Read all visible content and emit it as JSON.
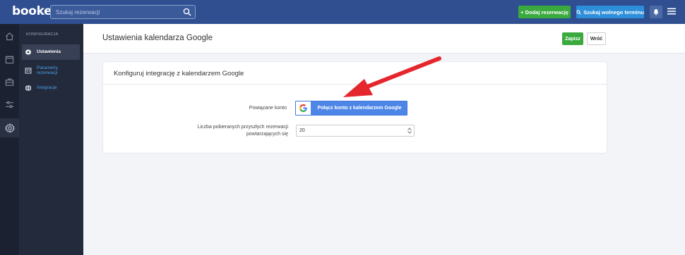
{
  "app": {
    "logo": "bookero"
  },
  "topbar": {
    "search_placeholder": "Szukaj rezerwacji",
    "add_reservation": "+ Dodaj rezerwację",
    "find_slot": "Szukaj wolnego terminu"
  },
  "sidebar": {
    "section": "KONFIGURACJA",
    "items": [
      {
        "label": "Ustawienia",
        "icon": "gear-icon",
        "active": true
      },
      {
        "label": "Parametry rezerwacji",
        "icon": "calendar-icon"
      },
      {
        "label": "Integracje",
        "icon": "globe-icon"
      }
    ]
  },
  "rail_icons": [
    "home-icon",
    "calendar-icon",
    "briefcase-icon",
    "sliders-icon",
    "gear-icon"
  ],
  "page": {
    "title": "Ustawienia kalendarza Google",
    "save": "Zapisz",
    "back": "Wróć"
  },
  "card": {
    "title": "Konfiguruj integrację z kalendarzem Google",
    "account_label": "Powiązane konto",
    "google_button": "Połącz konto z kalendarzem Google",
    "count_label_1": "Liczba pobieranych przyszłych rezerwacji",
    "count_label_2": "powtarzających się",
    "count_value": "20"
  },
  "colors": {
    "topbar": "#2f4f91",
    "green": "#3aaa3e",
    "blue_button": "#2d8fd9",
    "google_blue": "#4e86e8",
    "arrow_red": "#e5262d",
    "sidebar": "#232a3b",
    "rail": "#1b2130"
  }
}
